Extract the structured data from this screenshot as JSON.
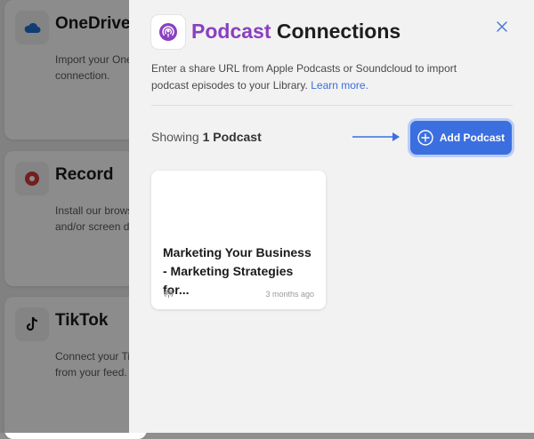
{
  "background_cards": [
    {
      "title": "OneDrive",
      "description_lines": [
        "Import your One",
        "connection."
      ],
      "icon": "onedrive-cloud-icon"
    },
    {
      "title": "Record",
      "description_lines": [
        "Install our brows",
        "and/or screen di"
      ],
      "icon": "record-icon"
    },
    {
      "title": "TikTok",
      "description_lines": [
        "Connect your Ti",
        "from your feed."
      ],
      "icon": "tiktok-icon"
    }
  ],
  "drawer": {
    "heading_accent": "Podcast",
    "heading_rest": " Connections",
    "intro_text": "Enter a share URL from Apple Podcasts or Soundcloud to import podcast episodes to your Library. ",
    "learn_more": "Learn more.",
    "showing_prefix": "Showing ",
    "showing_count": "1 Podcast",
    "add_button_label": "Add Podcast",
    "podcasts": [
      {
        "title": "Marketing Your Business - Marketing Strategies for...",
        "time": "3 months ago"
      }
    ]
  },
  "colors": {
    "accent_purple": "#8a3fc0",
    "primary_blue": "#3b6fe0",
    "link_blue": "#3a6fd8"
  }
}
